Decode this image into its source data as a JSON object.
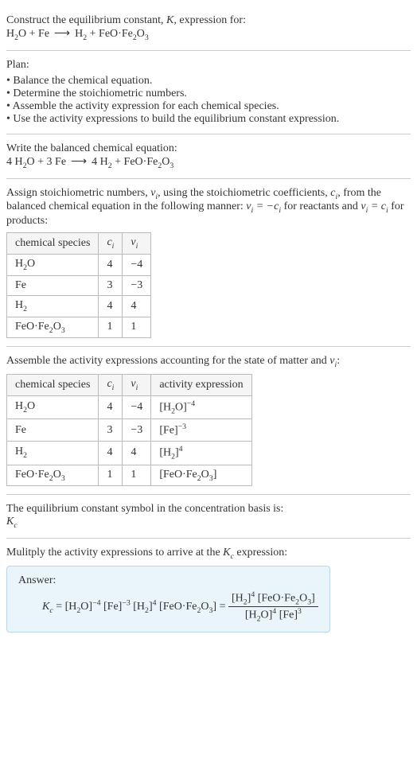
{
  "intro": {
    "line1": "Construct the equilibrium constant, ",
    "k": "K",
    "line1b": ", expression for:",
    "eq_lhs": "H",
    "eq": "H₂O + Fe  ⟶  H₂ + FeO·Fe₂O₃"
  },
  "plan": {
    "title": "Plan:",
    "items": [
      "Balance the chemical equation.",
      "Determine the stoichiometric numbers.",
      "Assemble the activity expression for each chemical species.",
      "Use the activity expressions to build the equilibrium constant expression."
    ]
  },
  "balanced": {
    "title": "Write the balanced chemical equation:",
    "eq": "4 H₂O + 3 Fe  ⟶  4 H₂ + FeO·Fe₂O₃"
  },
  "stoich": {
    "title_a": "Assign stoichiometric numbers, ",
    "nu": "νᵢ",
    "title_b": ", using the stoichiometric coefficients, ",
    "ci": "cᵢ",
    "title_c": ", from the balanced chemical equation in the following manner: ",
    "rel1": "νᵢ = −cᵢ",
    "title_d": " for reactants and ",
    "rel2": "νᵢ = cᵢ",
    "title_e": " for products:",
    "headers": [
      "chemical species",
      "cᵢ",
      "νᵢ"
    ],
    "rows": [
      [
        "H₂O",
        "4",
        "−4"
      ],
      [
        "Fe",
        "3",
        "−3"
      ],
      [
        "H₂",
        "4",
        "4"
      ],
      [
        "FeO·Fe₂O₃",
        "1",
        "1"
      ]
    ]
  },
  "activity": {
    "title_a": "Assemble the activity expressions accounting for the state of matter and ",
    "nu": "νᵢ",
    "title_b": ":",
    "headers": [
      "chemical species",
      "cᵢ",
      "νᵢ",
      "activity expression"
    ],
    "rows": [
      [
        "H₂O",
        "4",
        "−4",
        "[H₂O]⁻⁴"
      ],
      [
        "Fe",
        "3",
        "−3",
        "[Fe]⁻³"
      ],
      [
        "H₂",
        "4",
        "4",
        "[H₂]⁴"
      ],
      [
        "FeO·Fe₂O₃",
        "1",
        "1",
        "[FeO·Fe₂O₃]"
      ]
    ]
  },
  "symbol": {
    "title": "The equilibrium constant symbol in the concentration basis is:",
    "kc": "K_c"
  },
  "multiply": {
    "title_a": "Mulitply the activity expressions to arrive at the ",
    "kc": "K_c",
    "title_b": " expression:"
  },
  "answer": {
    "label": "Answer:",
    "kc": "K_c",
    "eq": " = [H₂O]⁻⁴ [Fe]⁻³ [H₂]⁴ [FeO·Fe₂O₃] = ",
    "frac_num": "[H₂]⁴ [FeO·Fe₂O₃]",
    "frac_den": "[H₂O]⁴ [Fe]³"
  }
}
